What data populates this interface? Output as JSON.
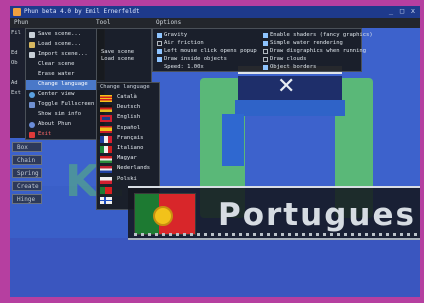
{
  "window": {
    "title": "Phun beta 4.0 by Emil Ernerfeldt",
    "controls": [
      "_",
      "□",
      "x"
    ]
  },
  "menubar": {
    "items": [
      "Phun",
      "Tool",
      "Options"
    ]
  },
  "file_menu": {
    "items": [
      {
        "label": "Save scene...",
        "icon_color": "#c8d0d8",
        "icon": "disk-icon"
      },
      {
        "label": "Load scene...",
        "icon_color": "#c8d0d8",
        "icon": "folder-icon"
      },
      {
        "label": "Import scene...",
        "icon_color": "#c8d0d8",
        "icon": "import-icon"
      },
      {
        "label": "Clear scene",
        "icon_color": "#28303a",
        "icon": "blank-icon"
      },
      {
        "label": "Erase water",
        "icon_color": "#28303a",
        "icon": "blank-icon"
      },
      {
        "label": "Change language",
        "icon_color": "#28303a",
        "icon": "blank-icon"
      },
      {
        "label": "Center view",
        "icon_color": "#5aa0e0",
        "icon": "target-icon"
      },
      {
        "label": "Toggle Fullscreen",
        "icon_color": "#7090d0",
        "icon": "monitor-icon"
      },
      {
        "label": "Show sim info",
        "icon_color": "#28303a",
        "icon": "blank-icon"
      },
      {
        "label": "About Phun",
        "icon_color": "#6a8cd8",
        "icon": "info-icon"
      },
      {
        "label": "Exit",
        "icon_color": "#e03a3a",
        "icon": "exit-icon"
      }
    ],
    "left_hotkeys": [
      "Fil",
      "Ed",
      "Ob",
      "Ad",
      "Ext"
    ]
  },
  "tool_menu": {
    "items": [
      "Save scene",
      "Load scene"
    ]
  },
  "options_panel": {
    "left": [
      {
        "label": "Gravity",
        "checked": true
      },
      {
        "label": "Air friction",
        "checked": false
      },
      {
        "label": "Left mouse click opens popup",
        "checked": true
      },
      {
        "label": "Draw inside objects",
        "checked": true
      },
      {
        "label": "Speed: 1.00x",
        "checked": false
      }
    ],
    "right": [
      {
        "label": "Enable shaders (fancy graphics)",
        "checked": true
      },
      {
        "label": "Simple water rendering",
        "checked": true
      },
      {
        "label": "Draw disgraphics when running",
        "checked": false
      },
      {
        "label": "Draw clouds",
        "checked": false
      },
      {
        "label": "Object borders",
        "checked": true
      }
    ]
  },
  "language_menu": {
    "title": "Change language",
    "items": [
      {
        "label": "Català",
        "flag": [
          "#f2c21a",
          "#d02020"
        ]
      },
      {
        "label": "Deutsch",
        "flag": [
          "#111111",
          "#e0c020"
        ]
      },
      {
        "label": "English",
        "flag": [
          "#1a3a8a",
          "#d02030"
        ]
      },
      {
        "label": "Español",
        "flag": [
          "#c81e28",
          "#f2c21a"
        ]
      },
      {
        "label": "Français",
        "flag": [
          "#2040a0",
          "#d82030"
        ]
      },
      {
        "label": "Italiano",
        "flag": [
          "#1c8a3a",
          "#d02020"
        ]
      },
      {
        "label": "Magyar",
        "flag": [
          "#d02020",
          "#2a8a3a"
        ]
      },
      {
        "label": "Nederlands",
        "flag": [
          "#c02030",
          "#2040a0"
        ]
      },
      {
        "label": "Polski",
        "flag": [
          "#f0f0f0",
          "#d02030"
        ]
      },
      {
        "label": "",
        "flag": [
          "#1c7a32",
          "#d82020"
        ]
      },
      {
        "label": "",
        "flag": [
          "#2050c0",
          "#f0f0f0"
        ]
      }
    ]
  },
  "selected_language": {
    "label": "Portugues",
    "flag": "portugal-flag"
  },
  "toolbar_left": [
    "Box",
    "Chain",
    "Spring",
    "Create",
    "Hinge"
  ],
  "colors": {
    "background_frame": "#b63fa0",
    "scene_sky": "#3a5fc8",
    "menu_bg": "#181a1e",
    "highlight": "#4a78c8",
    "green_object": "#5ab878"
  }
}
